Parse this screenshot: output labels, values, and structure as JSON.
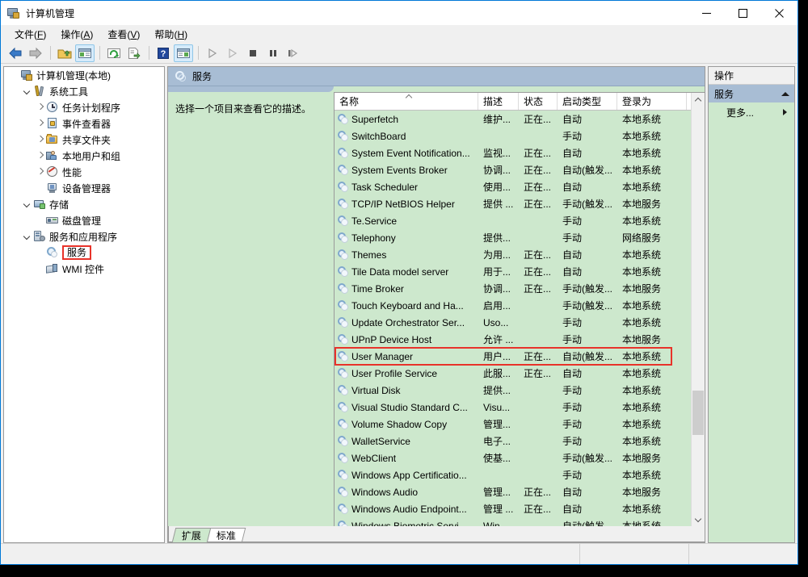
{
  "window": {
    "title": "计算机管理",
    "icon": "computer-management-icon",
    "controls": {
      "minimize": "minimize-icon",
      "maximize": "maximize-icon",
      "close": "close-icon"
    }
  },
  "menubar": {
    "items": [
      {
        "label": "文件(F)",
        "text": "文件",
        "accel": "F"
      },
      {
        "label": "操作(A)",
        "text": "操作",
        "accel": "A"
      },
      {
        "label": "查看(V)",
        "text": "查看",
        "accel": "V"
      },
      {
        "label": "帮助(H)",
        "text": "帮助",
        "accel": "H"
      }
    ]
  },
  "toolbar": {
    "buttons": [
      {
        "name": "back-icon",
        "pressed": false
      },
      {
        "name": "forward-icon",
        "pressed": false
      },
      {
        "name": "up-folder-icon",
        "pressed": false
      },
      {
        "name": "show-hide-tree-icon",
        "pressed": true
      },
      {
        "name": "refresh-icon",
        "pressed": false
      },
      {
        "name": "export-list-icon",
        "pressed": false
      },
      {
        "name": "help-icon",
        "pressed": false
      },
      {
        "name": "show-action-pane-icon",
        "pressed": true
      },
      {
        "name": "start-service-icon",
        "pressed": false
      },
      {
        "name": "resume-service-icon",
        "pressed": false
      },
      {
        "name": "stop-service-icon",
        "pressed": false
      },
      {
        "name": "pause-service-icon",
        "pressed": false
      },
      {
        "name": "restart-service-icon",
        "pressed": false
      }
    ]
  },
  "tree": {
    "nodes": [
      {
        "label": "计算机管理(本地)",
        "indent": 0,
        "twisty": "none",
        "icon": "computer-icon",
        "selected": false
      },
      {
        "label": "系统工具",
        "indent": 1,
        "twisty": "open",
        "icon": "tools-icon",
        "selected": false
      },
      {
        "label": "任务计划程序",
        "indent": 2,
        "twisty": "closed",
        "icon": "clock-icon",
        "selected": false
      },
      {
        "label": "事件查看器",
        "indent": 2,
        "twisty": "closed",
        "icon": "event-icon",
        "selected": false
      },
      {
        "label": "共享文件夹",
        "indent": 2,
        "twisty": "closed",
        "icon": "folder-icon",
        "selected": false
      },
      {
        "label": "本地用户和组",
        "indent": 2,
        "twisty": "closed",
        "icon": "users-icon",
        "selected": false
      },
      {
        "label": "性能",
        "indent": 2,
        "twisty": "closed",
        "icon": "perf-icon",
        "selected": false
      },
      {
        "label": "设备管理器",
        "indent": 2,
        "twisty": "none",
        "icon": "device-icon",
        "selected": false
      },
      {
        "label": "存储",
        "indent": 1,
        "twisty": "open",
        "icon": "storage-icon",
        "selected": false
      },
      {
        "label": "磁盘管理",
        "indent": 2,
        "twisty": "none",
        "icon": "disk-icon",
        "selected": false
      },
      {
        "label": "服务和应用程序",
        "indent": 1,
        "twisty": "open",
        "icon": "services-app-icon",
        "selected": false
      },
      {
        "label": "服务",
        "indent": 2,
        "twisty": "none",
        "icon": "gear-icon",
        "selected": true
      },
      {
        "label": "WMI 控件",
        "indent": 2,
        "twisty": "none",
        "icon": "wmi-icon",
        "selected": false
      }
    ]
  },
  "pane": {
    "header_title": "服务",
    "header_icon": "gear-icon",
    "description": "选择一个项目来查看它的描述。"
  },
  "grid": {
    "columns": [
      {
        "label": "名称",
        "width": 178,
        "sorted": true
      },
      {
        "label": "描述",
        "width": 50,
        "sorted": false
      },
      {
        "label": "状态",
        "width": 48,
        "sorted": false
      },
      {
        "label": "启动类型",
        "width": 74,
        "sorted": false
      },
      {
        "label": "登录为",
        "width": 86,
        "sorted": false
      },
      {
        "label": "",
        "width": 40,
        "sorted": false
      }
    ],
    "rows": [
      {
        "name": "Superfetch",
        "desc": "维护...",
        "status": "正在...",
        "startup": "自动",
        "logon": "本地系统",
        "highlighted": false
      },
      {
        "name": "SwitchBoard",
        "desc": "",
        "status": "",
        "startup": "手动",
        "logon": "本地系统",
        "highlighted": false
      },
      {
        "name": "System Event Notification...",
        "desc": "监视...",
        "status": "正在...",
        "startup": "自动",
        "logon": "本地系统",
        "highlighted": false
      },
      {
        "name": "System Events Broker",
        "desc": "协调...",
        "status": "正在...",
        "startup": "自动(触发...",
        "logon": "本地系统",
        "highlighted": false
      },
      {
        "name": "Task Scheduler",
        "desc": "使用...",
        "status": "正在...",
        "startup": "自动",
        "logon": "本地系统",
        "highlighted": false
      },
      {
        "name": "TCP/IP NetBIOS Helper",
        "desc": "提供 ...",
        "status": "正在...",
        "startup": "手动(触发...",
        "logon": "本地服务",
        "highlighted": false
      },
      {
        "name": "Te.Service",
        "desc": "",
        "status": "",
        "startup": "手动",
        "logon": "本地系统",
        "highlighted": false
      },
      {
        "name": "Telephony",
        "desc": "提供...",
        "status": "",
        "startup": "手动",
        "logon": "网络服务",
        "highlighted": false
      },
      {
        "name": "Themes",
        "desc": "为用...",
        "status": "正在...",
        "startup": "自动",
        "logon": "本地系统",
        "highlighted": false
      },
      {
        "name": "Tile Data model server",
        "desc": "用于...",
        "status": "正在...",
        "startup": "自动",
        "logon": "本地系统",
        "highlighted": false
      },
      {
        "name": "Time Broker",
        "desc": "协调...",
        "status": "正在...",
        "startup": "手动(触发...",
        "logon": "本地服务",
        "highlighted": false
      },
      {
        "name": "Touch Keyboard and Ha...",
        "desc": "启用...",
        "status": "",
        "startup": "手动(触发...",
        "logon": "本地系统",
        "highlighted": false
      },
      {
        "name": "Update Orchestrator Ser...",
        "desc": "Uso...",
        "status": "",
        "startup": "手动",
        "logon": "本地系统",
        "highlighted": false
      },
      {
        "name": "UPnP Device Host",
        "desc": "允许 ...",
        "status": "",
        "startup": "手动",
        "logon": "本地服务",
        "highlighted": false
      },
      {
        "name": "User Manager",
        "desc": "用户...",
        "status": "正在...",
        "startup": "自动(触发...",
        "logon": "本地系统",
        "highlighted": true
      },
      {
        "name": "User Profile Service",
        "desc": "此服...",
        "status": "正在...",
        "startup": "自动",
        "logon": "本地系统",
        "highlighted": false
      },
      {
        "name": "Virtual Disk",
        "desc": "提供...",
        "status": "",
        "startup": "手动",
        "logon": "本地系统",
        "highlighted": false
      },
      {
        "name": "Visual Studio Standard C...",
        "desc": "Visu...",
        "status": "",
        "startup": "手动",
        "logon": "本地系统",
        "highlighted": false
      },
      {
        "name": "Volume Shadow Copy",
        "desc": "管理...",
        "status": "",
        "startup": "手动",
        "logon": "本地系统",
        "highlighted": false
      },
      {
        "name": "WalletService",
        "desc": "电子...",
        "status": "",
        "startup": "手动",
        "logon": "本地系统",
        "highlighted": false
      },
      {
        "name": "WebClient",
        "desc": "使基...",
        "status": "",
        "startup": "手动(触发...",
        "logon": "本地服务",
        "highlighted": false
      },
      {
        "name": "Windows App Certificatio...",
        "desc": "",
        "status": "",
        "startup": "手动",
        "logon": "本地系统",
        "highlighted": false
      },
      {
        "name": "Windows Audio",
        "desc": "管理...",
        "status": "正在...",
        "startup": "自动",
        "logon": "本地服务",
        "highlighted": false
      },
      {
        "name": "Windows Audio Endpoint...",
        "desc": "管理 ...",
        "status": "正在...",
        "startup": "自动",
        "logon": "本地系统",
        "highlighted": false
      },
      {
        "name": "Windows Biometric Servi...",
        "desc": "Win...",
        "status": "",
        "startup": "自动(触发...",
        "logon": "本地系统",
        "highlighted": false
      }
    ],
    "scrollbar": {
      "up": "scroll-up-icon",
      "down": "scroll-down-icon",
      "thumb_top_pct": 70,
      "thumb_height_pct": 11
    }
  },
  "tabs": [
    {
      "label": "扩展",
      "active": true
    },
    {
      "label": "标准",
      "active": false
    }
  ],
  "actions": {
    "title": "操作",
    "group": {
      "label": "服务",
      "collapse_icon": "caret-up-icon"
    },
    "items": [
      {
        "label": "更多...",
        "submenu_icon": "caret-right-icon"
      }
    ]
  },
  "colors": {
    "accent_blue": "#0078d7",
    "pane_header": "#a8bdd4",
    "content_green": "#cde8cd",
    "highlight_red": "#e8332a",
    "chrome": "#f0f0f0"
  }
}
